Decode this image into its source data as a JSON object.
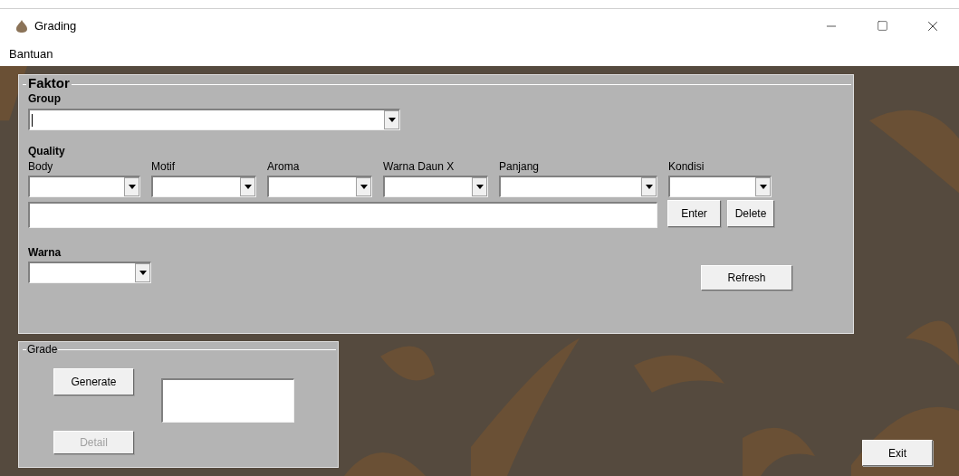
{
  "window": {
    "title": "Grading"
  },
  "menu": [
    "Bantuan"
  ],
  "faktor": {
    "legend": "Faktor",
    "group": {
      "label": "Group",
      "focused": true
    },
    "quality": {
      "label": "Quality",
      "fields": [
        {
          "label": "Body"
        },
        {
          "label": "Motif"
        },
        {
          "label": "Aroma"
        },
        {
          "label": "Warna Daun X"
        },
        {
          "label": "Panjang"
        },
        {
          "label": "Kondisi"
        }
      ],
      "enter": "Enter",
      "delete": "Delete"
    },
    "warna": {
      "label": "Warna"
    },
    "refresh": "Refresh"
  },
  "grade": {
    "legend": "Grade",
    "generate": {
      "label": "Generate",
      "disabled": false
    },
    "detail": {
      "label": "Detail",
      "disabled": true
    }
  },
  "exit": "Exit"
}
